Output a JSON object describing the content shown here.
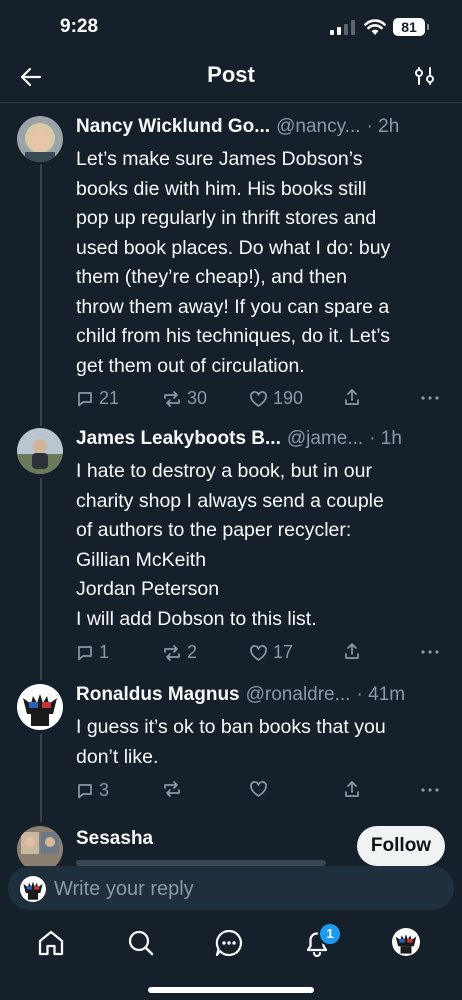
{
  "status_bar": {
    "time": "9:28",
    "battery": "81"
  },
  "header": {
    "title": "Post"
  },
  "tweets": [
    {
      "name": "Nancy Wicklund Go...",
      "handle": "@nancy...",
      "time": "· 2h",
      "lines": [
        "Let’s make sure James Dobson’s",
        "books die with him. His books still",
        "pop up regularly in thrift stores and",
        "used book places. Do what I do: buy",
        "them (they’re cheap!), and then",
        "throw them away! If you can spare a",
        "child from his techniques, do it. Let’s",
        "get them out of circulation."
      ],
      "replies": "21",
      "reposts": "30",
      "likes": "190"
    },
    {
      "name": "James Leakyboots B...",
      "handle": "@jame...",
      "time": "· 1h",
      "lines": [
        "I hate to destroy a book, but in our",
        "charity shop I always send a couple",
        "of authors to the paper recycler:",
        "Gillian McKeith",
        "Jordan Peterson",
        "I will add Dobson to this list."
      ],
      "replies": "1",
      "reposts": "2",
      "likes": "17"
    },
    {
      "name": "Ronaldus Magnus",
      "handle": "@ronaldre...",
      "time": "· 41m",
      "lines": [
        "I guess it’s ok to ban books that you",
        "don’t like."
      ],
      "replies": "3",
      "reposts": "",
      "likes": ""
    },
    {
      "name": "Sesasha",
      "handle": "",
      "time": "",
      "lines": [],
      "replies": "",
      "reposts": "",
      "likes": ""
    }
  ],
  "follow_label": "Follow",
  "reply": {
    "placeholder": "Write your reply"
  },
  "nav": {
    "items": [
      "home-icon",
      "search-icon",
      "grok-icon",
      "notifications-icon",
      "profile-avatar"
    ],
    "notification_badge": "1"
  },
  "colors": {
    "background": "#15202b",
    "accent": "#1d9bf0",
    "secondary_text": "#8b98a5",
    "divider": "#2f3b47"
  }
}
